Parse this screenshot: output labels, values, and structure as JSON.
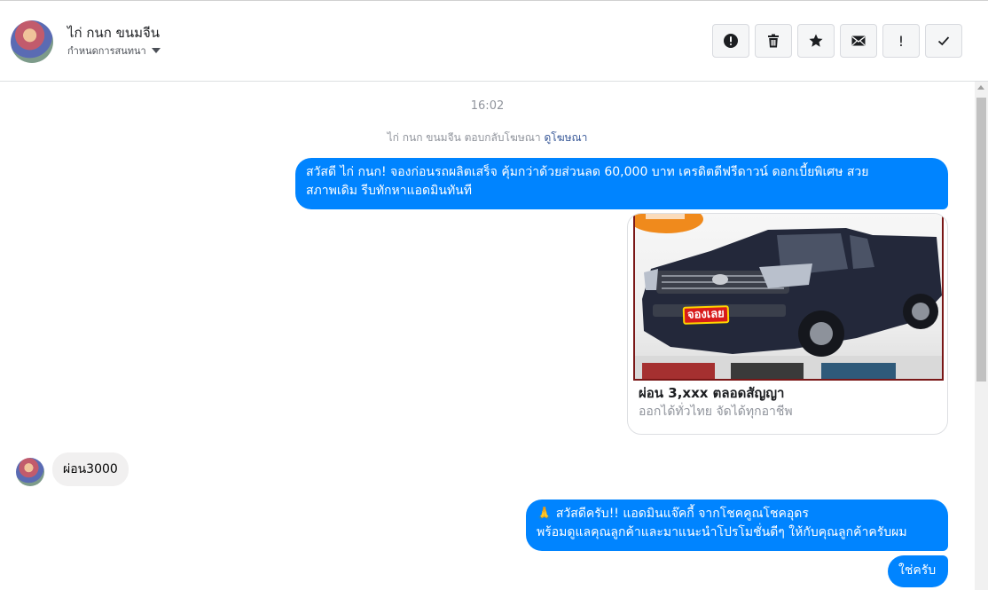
{
  "header": {
    "contact_name": "ไก่ กนก ขนมจีน",
    "assign_label": "กำหนดการสนทนา",
    "actions": [
      {
        "icon": "alert-circle-icon"
      },
      {
        "icon": "trash-icon"
      },
      {
        "icon": "star-icon"
      },
      {
        "icon": "envelope-icon"
      },
      {
        "icon": "exclamation-icon",
        "glyph": "!"
      },
      {
        "icon": "checkmark-icon"
      }
    ]
  },
  "chat": {
    "timestamp": "16:02",
    "reply_note": {
      "text": "ไก่ กนก ขนมจีน ตอบกลับโฆษณา",
      "link": "ดูโฆษณา"
    },
    "messages": [
      {
        "direction": "out",
        "lines": [
          "สวัสดี ไก่ กนก! จองก่อนรถผลิตเสร็จ คุ้มกว่าด้วยส่วนลด 60,000 บาท เครดิตดีฟรีดาวน์ ดอกเบี้ยพิเศษ สวย",
          "สภาพเดิม รีบทักหาแอดมินทันที"
        ]
      },
      {
        "direction": "out",
        "type": "ad-card",
        "badge_text": "จองเลย",
        "title": "ผ่อน 3,xxx ตลอดสัญญา",
        "subtitle": "ออกได้ทั่วไทย จัดได้ทุกอาชีพ"
      },
      {
        "direction": "in",
        "text": "ผ่อน3000"
      },
      {
        "direction": "out",
        "lines": [
          "🙏 สวัสดีครับ!! แอดมินแจ๊คกี้ จากโชคคูณโชคอุดร",
          "พร้อมดูแลคุณลูกค้าและมาแนะนำโปรโมชั่นดีๆ ให้กับคุณลูกค้าครับผม"
        ]
      },
      {
        "direction": "out",
        "text": "ใช่ครับ"
      }
    ]
  },
  "colors": {
    "accent": "#0084ff",
    "incoming_bubble": "#f1f0f0",
    "link": "#385898",
    "muted": "#90949c"
  }
}
